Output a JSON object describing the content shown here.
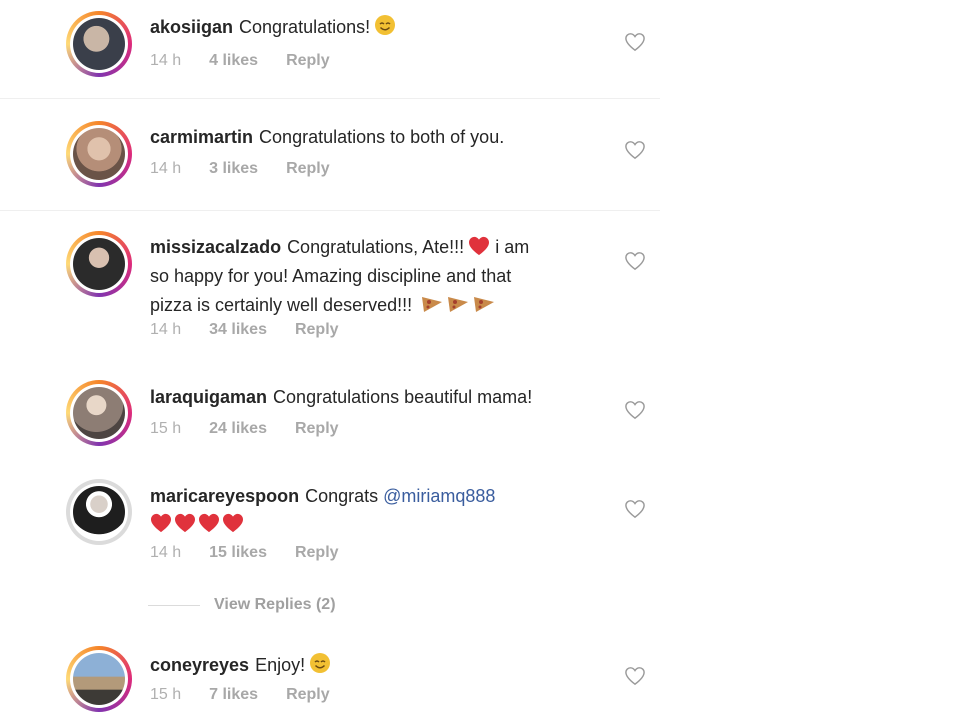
{
  "comments": [
    {
      "username": "akosiigan",
      "text": "Congratulations!",
      "emoji": "smiling-face-icon",
      "time": "14 h",
      "likes": "4 likes",
      "reply": "Reply",
      "avatar_color": "#3a3f4a"
    },
    {
      "username": "carmimartin",
      "text": "Congratulations to both of you.",
      "time": "14 h",
      "likes": "3 likes",
      "reply": "Reply",
      "avatar_color": "#c9a28a"
    },
    {
      "username": "missizacalzado",
      "text_line1": "Congratulations, Ate!!!",
      "text_line1b": "i am",
      "text_line2": "so happy for you! Amazing discipline and that",
      "text_line3": "pizza is certainly well deserved!!!",
      "time": "14 h",
      "likes": "34 likes",
      "reply": "Reply",
      "avatar_color": "#2b2b2b"
    },
    {
      "username": "laraquigaman",
      "text": "Congratulations beautiful mama!",
      "time": "15 h",
      "likes": "24 likes",
      "reply": "Reply",
      "avatar_color": "#7a6b66"
    },
    {
      "username": "maricareyespoon",
      "text": "Congrats",
      "mention": "@miriamq888",
      "time": "14 h",
      "likes": "15 likes",
      "reply": "Reply",
      "avatar_color": "#1e1e1e"
    },
    {
      "username": "coneyreyes",
      "text": "Enjoy!",
      "emoji": "smiling-face-icon",
      "time": "15 h",
      "likes": "7 likes",
      "reply": "Reply",
      "avatar_color": "#8db0d6"
    }
  ],
  "view_replies": "View Replies (2)",
  "colors": {
    "mention": "#3a5d9e",
    "heart_red": "#e0323c",
    "meta_gray": "#a8a8a8"
  }
}
